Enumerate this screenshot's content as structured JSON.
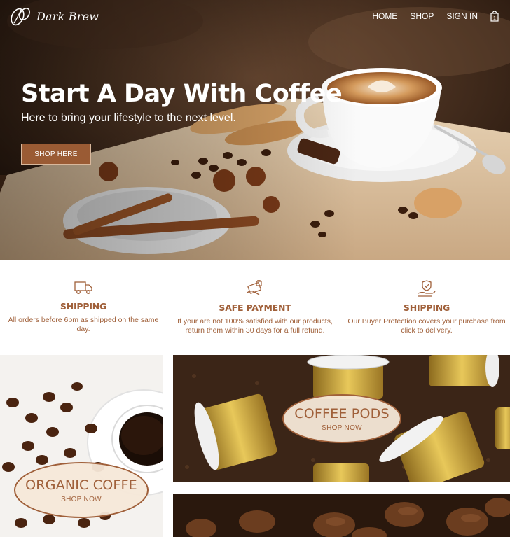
{
  "brand": {
    "name": "Dark Brew"
  },
  "nav": {
    "items": [
      {
        "label": "HOME"
      },
      {
        "label": "SHOP"
      },
      {
        "label": "SIGN IN"
      }
    ],
    "cart_count": "1"
  },
  "hero": {
    "title": "Start A Day With Coffee",
    "subtitle": "Here to bring your lifestyle to the next level.",
    "button_label": "SHOP HERE"
  },
  "features": [
    {
      "icon": "truck-icon",
      "title": "SHIPPING",
      "text": "All orders before 6pm as shipped on the same day."
    },
    {
      "icon": "secure-payment-icon",
      "title": "SAFE PAYMENT",
      "text": "If your are not 100% satisfied with our products, return them within 30 days for a full refund."
    },
    {
      "icon": "hand-shield-icon",
      "title": "SHIPPING",
      "text": "Our Buyer Protection covers your purchase from click to delivery."
    }
  ],
  "tiles": {
    "organic": {
      "title": "ORGANIC COFFE",
      "cta": "SHOP NOW"
    },
    "pods": {
      "title": "COFFEE PODS",
      "cta": "SHOP NOW"
    }
  },
  "colors": {
    "accent": "#a0603a",
    "button": "#9a5b34",
    "oval_fill": "#f6e8d8"
  }
}
